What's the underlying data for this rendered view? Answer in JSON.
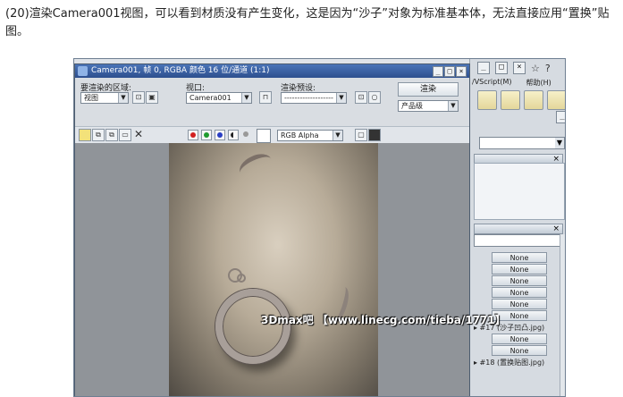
{
  "caption": "(20)渲染Camera001视图，可以看到材质没有产生变化，这是因为“沙子”对象为标准基本体，无法直接应用“置换”贴图。",
  "main_window": {
    "menu_items": [
      "/VScript(M)",
      "帮助(H)"
    ],
    "star_glyph": "☆",
    "help_glyph": "?",
    "dropdown_glyph": "▼",
    "section_close": "×",
    "material_slots": [
      "None",
      "None",
      "None",
      "None",
      "None",
      "None"
    ],
    "maps": [
      {
        "label": "▸ #17 (沙子凹凸.jpg)"
      },
      {
        "label": "None"
      },
      {
        "label": "None"
      },
      {
        "label": "▸ #18 (置换贴图.jpg)"
      }
    ]
  },
  "render_window": {
    "title": "Camera001, 帧 0, RGBA 颜色 16 位/通道 (1:1)",
    "area_label": "要渲染的区域:",
    "area_value": "视图",
    "viewport_label": "视口:",
    "viewport_value": "Camera001",
    "preset_label": "渲染预设:",
    "preset_value": "-------------------",
    "render_button": "渲染",
    "quality_value": "产品级",
    "channel_value": "RGB Alpha",
    "close_glyph": "✕"
  },
  "colors": {
    "red_channel": "#d22020",
    "green_channel": "#1f9a2e",
    "blue_channel": "#2a3fc4"
  },
  "watermark": "3Dmax吧 【www.linecg.com/tieba/1771】"
}
